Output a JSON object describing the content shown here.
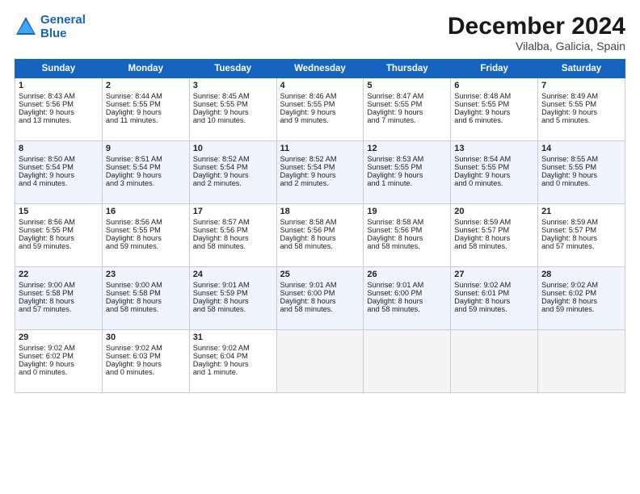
{
  "logo": {
    "line1": "General",
    "line2": "Blue"
  },
  "title": "December 2024",
  "location": "Vilalba, Galicia, Spain",
  "weekdays": [
    "Sunday",
    "Monday",
    "Tuesday",
    "Wednesday",
    "Thursday",
    "Friday",
    "Saturday"
  ],
  "weeks": [
    [
      {
        "day": "1",
        "lines": [
          "Sunrise: 8:43 AM",
          "Sunset: 5:56 PM",
          "Daylight: 9 hours",
          "and 13 minutes."
        ]
      },
      {
        "day": "2",
        "lines": [
          "Sunrise: 8:44 AM",
          "Sunset: 5:55 PM",
          "Daylight: 9 hours",
          "and 11 minutes."
        ]
      },
      {
        "day": "3",
        "lines": [
          "Sunrise: 8:45 AM",
          "Sunset: 5:55 PM",
          "Daylight: 9 hours",
          "and 10 minutes."
        ]
      },
      {
        "day": "4",
        "lines": [
          "Sunrise: 8:46 AM",
          "Sunset: 5:55 PM",
          "Daylight: 9 hours",
          "and 9 minutes."
        ]
      },
      {
        "day": "5",
        "lines": [
          "Sunrise: 8:47 AM",
          "Sunset: 5:55 PM",
          "Daylight: 9 hours",
          "and 7 minutes."
        ]
      },
      {
        "day": "6",
        "lines": [
          "Sunrise: 8:48 AM",
          "Sunset: 5:55 PM",
          "Daylight: 9 hours",
          "and 6 minutes."
        ]
      },
      {
        "day": "7",
        "lines": [
          "Sunrise: 8:49 AM",
          "Sunset: 5:55 PM",
          "Daylight: 9 hours",
          "and 5 minutes."
        ]
      }
    ],
    [
      {
        "day": "8",
        "lines": [
          "Sunrise: 8:50 AM",
          "Sunset: 5:54 PM",
          "Daylight: 9 hours",
          "and 4 minutes."
        ]
      },
      {
        "day": "9",
        "lines": [
          "Sunrise: 8:51 AM",
          "Sunset: 5:54 PM",
          "Daylight: 9 hours",
          "and 3 minutes."
        ]
      },
      {
        "day": "10",
        "lines": [
          "Sunrise: 8:52 AM",
          "Sunset: 5:54 PM",
          "Daylight: 9 hours",
          "and 2 minutes."
        ]
      },
      {
        "day": "11",
        "lines": [
          "Sunrise: 8:52 AM",
          "Sunset: 5:54 PM",
          "Daylight: 9 hours",
          "and 2 minutes."
        ]
      },
      {
        "day": "12",
        "lines": [
          "Sunrise: 8:53 AM",
          "Sunset: 5:55 PM",
          "Daylight: 9 hours",
          "and 1 minute."
        ]
      },
      {
        "day": "13",
        "lines": [
          "Sunrise: 8:54 AM",
          "Sunset: 5:55 PM",
          "Daylight: 9 hours",
          "and 0 minutes."
        ]
      },
      {
        "day": "14",
        "lines": [
          "Sunrise: 8:55 AM",
          "Sunset: 5:55 PM",
          "Daylight: 9 hours",
          "and 0 minutes."
        ]
      }
    ],
    [
      {
        "day": "15",
        "lines": [
          "Sunrise: 8:56 AM",
          "Sunset: 5:55 PM",
          "Daylight: 8 hours",
          "and 59 minutes."
        ]
      },
      {
        "day": "16",
        "lines": [
          "Sunrise: 8:56 AM",
          "Sunset: 5:55 PM",
          "Daylight: 8 hours",
          "and 59 minutes."
        ]
      },
      {
        "day": "17",
        "lines": [
          "Sunrise: 8:57 AM",
          "Sunset: 5:56 PM",
          "Daylight: 8 hours",
          "and 58 minutes."
        ]
      },
      {
        "day": "18",
        "lines": [
          "Sunrise: 8:58 AM",
          "Sunset: 5:56 PM",
          "Daylight: 8 hours",
          "and 58 minutes."
        ]
      },
      {
        "day": "19",
        "lines": [
          "Sunrise: 8:58 AM",
          "Sunset: 5:56 PM",
          "Daylight: 8 hours",
          "and 58 minutes."
        ]
      },
      {
        "day": "20",
        "lines": [
          "Sunrise: 8:59 AM",
          "Sunset: 5:57 PM",
          "Daylight: 8 hours",
          "and 58 minutes."
        ]
      },
      {
        "day": "21",
        "lines": [
          "Sunrise: 8:59 AM",
          "Sunset: 5:57 PM",
          "Daylight: 8 hours",
          "and 57 minutes."
        ]
      }
    ],
    [
      {
        "day": "22",
        "lines": [
          "Sunrise: 9:00 AM",
          "Sunset: 5:58 PM",
          "Daylight: 8 hours",
          "and 57 minutes."
        ]
      },
      {
        "day": "23",
        "lines": [
          "Sunrise: 9:00 AM",
          "Sunset: 5:58 PM",
          "Daylight: 8 hours",
          "and 58 minutes."
        ]
      },
      {
        "day": "24",
        "lines": [
          "Sunrise: 9:01 AM",
          "Sunset: 5:59 PM",
          "Daylight: 8 hours",
          "and 58 minutes."
        ]
      },
      {
        "day": "25",
        "lines": [
          "Sunrise: 9:01 AM",
          "Sunset: 6:00 PM",
          "Daylight: 8 hours",
          "and 58 minutes."
        ]
      },
      {
        "day": "26",
        "lines": [
          "Sunrise: 9:01 AM",
          "Sunset: 6:00 PM",
          "Daylight: 8 hours",
          "and 58 minutes."
        ]
      },
      {
        "day": "27",
        "lines": [
          "Sunrise: 9:02 AM",
          "Sunset: 6:01 PM",
          "Daylight: 8 hours",
          "and 59 minutes."
        ]
      },
      {
        "day": "28",
        "lines": [
          "Sunrise: 9:02 AM",
          "Sunset: 6:02 PM",
          "Daylight: 8 hours",
          "and 59 minutes."
        ]
      }
    ],
    [
      {
        "day": "29",
        "lines": [
          "Sunrise: 9:02 AM",
          "Sunset: 6:02 PM",
          "Daylight: 9 hours",
          "and 0 minutes."
        ]
      },
      {
        "day": "30",
        "lines": [
          "Sunrise: 9:02 AM",
          "Sunset: 6:03 PM",
          "Daylight: 9 hours",
          "and 0 minutes."
        ]
      },
      {
        "day": "31",
        "lines": [
          "Sunrise: 9:02 AM",
          "Sunset: 6:04 PM",
          "Daylight: 9 hours",
          "and 1 minute."
        ]
      },
      {
        "day": "",
        "lines": []
      },
      {
        "day": "",
        "lines": []
      },
      {
        "day": "",
        "lines": []
      },
      {
        "day": "",
        "lines": []
      }
    ]
  ]
}
